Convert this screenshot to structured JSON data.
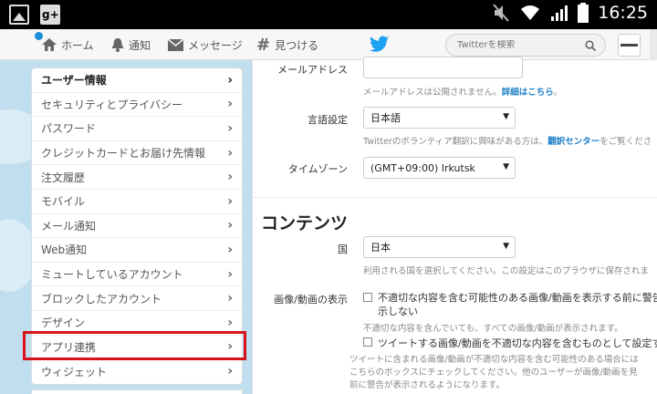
{
  "statusbar": {
    "time": "16:25"
  },
  "nav": {
    "home": "ホーム",
    "notifications": "通知",
    "messages": "メッセージ",
    "discover": "見つける",
    "search_placeholder": "Twitterを検索"
  },
  "sidebar": {
    "items": [
      {
        "label": "ユーザー情報"
      },
      {
        "label": "セキュリティとプライバシー"
      },
      {
        "label": "パスワード"
      },
      {
        "label": "クレジットカードとお届け先情報"
      },
      {
        "label": "注文履歴"
      },
      {
        "label": "モバイル"
      },
      {
        "label": "メール通知"
      },
      {
        "label": "Web通知"
      },
      {
        "label": "ミュートしているアカウント"
      },
      {
        "label": "ブロックしたアカウント"
      },
      {
        "label": "デザイン"
      },
      {
        "label": "アプリ連携"
      },
      {
        "label": "ウィジェット"
      }
    ]
  },
  "account": {
    "email_label": "メールアドレス",
    "email_value": "",
    "email_help": "メールアドレスは公開されません。",
    "email_help_link": "詳細はこちら",
    "email_help_end": "。",
    "language_label": "言語設定",
    "language_value": "日本語",
    "language_help": "Twitterのボランティア翻訳に興味がある方は、",
    "language_help_link": "翻訳センター",
    "language_help_end": "をご覧くださ",
    "timezone_label": "タイムゾーン",
    "timezone_value": "(GMT+09:00) Irkutsk"
  },
  "content": {
    "title": "コンテンツ",
    "country_label": "国",
    "country_value": "日本",
    "country_help": "利用される国を選択してください。この設定はこのブラウザに保存されま",
    "media_label": "画像/動画の表示",
    "media_checkbox_line1": "不適切な内容を含む可能性のある画像/動画を表示する前に警告を",
    "media_checkbox_line2": "示しない",
    "media_help": "不適切な内容を含んでいても、すべての画像/動画が表示されます。",
    "tweet_media_checkbox": "ツイートする画像/動画を不適切な内容を含むものとして設定する",
    "tweet_media_help1": "ツイートに含まれる画像/動画が不適切な内容を含む可能性のある場合には",
    "tweet_media_help2": "こちらのボックスにチェックしてください。他のユーザーが画像/動画を見",
    "tweet_media_help3": "前に警告が表示されるようになります。"
  },
  "colors": {
    "accent": "#1d8dd6",
    "highlight": "#d8111b",
    "twitter": "#1da1f2"
  }
}
